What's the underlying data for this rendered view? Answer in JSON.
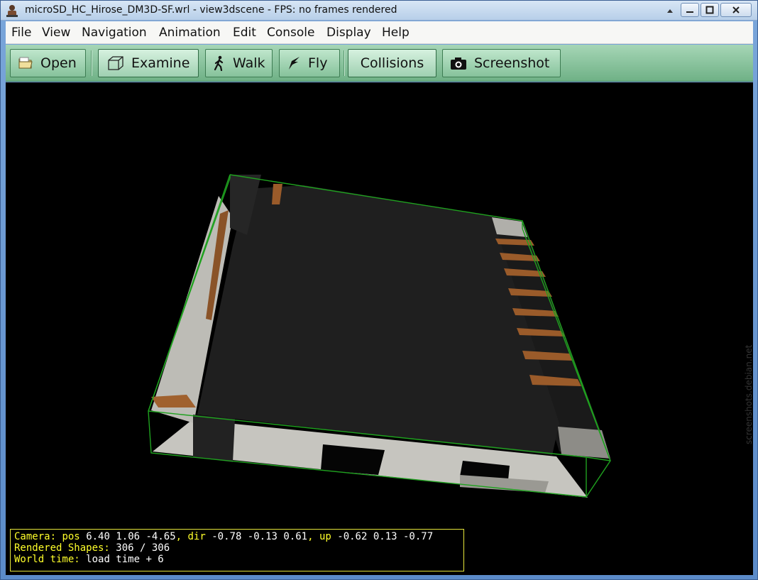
{
  "window": {
    "title": "microSD_HC_Hirose_DM3D-SF.wrl - view3dscene - FPS: no frames rendered"
  },
  "menubar": {
    "items": [
      "File",
      "View",
      "Navigation",
      "Animation",
      "Edit",
      "Console",
      "Display",
      "Help"
    ]
  },
  "toolbar": {
    "open_label": "Open",
    "examine_label": "Examine",
    "walk_label": "Walk",
    "fly_label": "Fly",
    "collisions_label": "Collisions",
    "screenshot_label": "Screenshot",
    "active_mode": "Examine"
  },
  "status": {
    "camera_label": "Camera:",
    "pos_label": "pos",
    "pos_value": "6.40 1.06 -4.65",
    "dir_label": "dir",
    "dir_value": "-0.78 -0.13 0.61",
    "up_label": "up",
    "up_value": "-0.62 0.13 -0.77",
    "shapes_label": "Rendered Shapes:",
    "shapes_value": "306 / 306",
    "world_time_label": "World time:",
    "world_time_value": "load time + 6"
  },
  "watermark": "screenshots.debian.net",
  "colors": {
    "bounding_box": "#1fa11f",
    "body_dark": "#1e1e1e",
    "body_light": "#c9c8c2",
    "contacts": "#9a5b2a",
    "status_yellow": "#ffff2a"
  }
}
